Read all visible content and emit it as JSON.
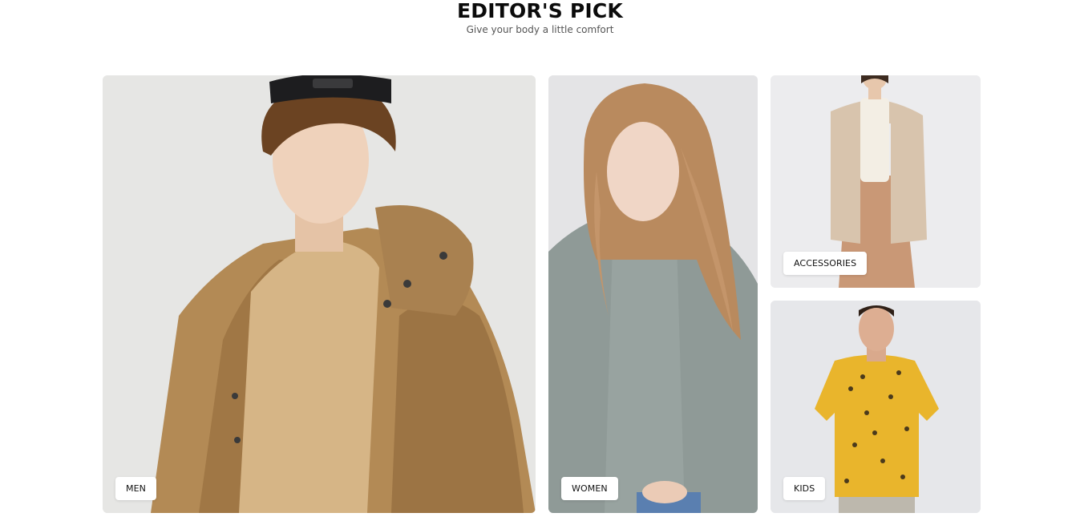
{
  "section": {
    "title": "EDITOR'S PICK",
    "subtitle": "Give your body a little comfort"
  },
  "categories": [
    {
      "label": "MEN",
      "photo": "man in tan hooded jacket and backwards cap"
    },
    {
      "label": "WOMEN",
      "photo": "woman with long wavy hair in grey sweater"
    },
    {
      "label": "ACCESSORIES",
      "photo": "woman in beige cardigan and wide trousers"
    },
    {
      "label": "KIDS",
      "photo": "man in yellow patterned short-sleeve shirt"
    }
  ],
  "colors": {
    "background": "#ffffff",
    "title": "#0b0b0b",
    "subtitle": "#555555",
    "label_bg": "#ffffff"
  }
}
